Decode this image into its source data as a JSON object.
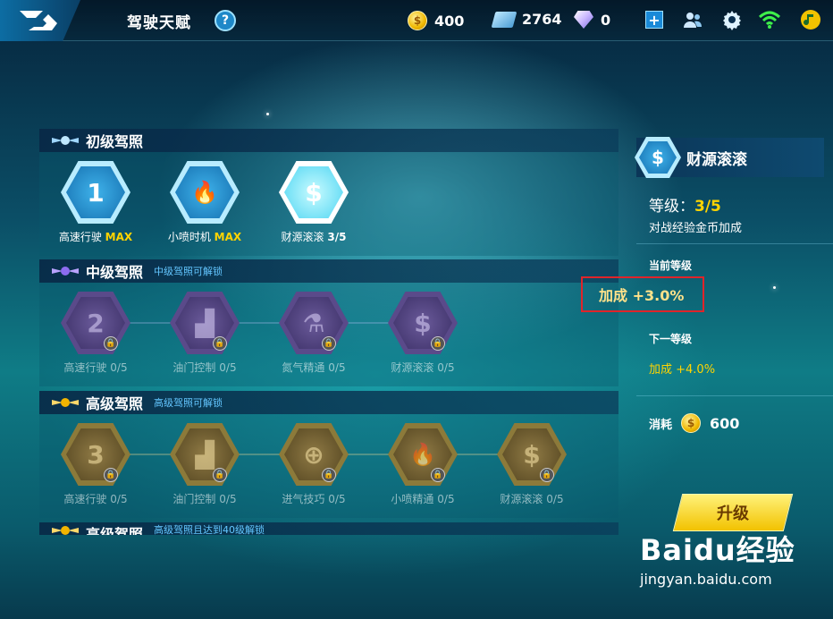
{
  "header": {
    "title": "驾驶天赋",
    "help": "?",
    "gold": "400",
    "coupons": "2764",
    "diamonds": "0",
    "add_label": "+"
  },
  "tiers": [
    {
      "name": "初级驾照",
      "subtitle": "",
      "nodes": [
        {
          "icon": "speedometer-1-icon",
          "glyph": "1",
          "label": "高速行驶",
          "level": "MAX",
          "locked": false
        },
        {
          "icon": "nitro-flame-icon",
          "glyph": "🔥",
          "label": "小喷时机",
          "level": "MAX",
          "locked": false
        },
        {
          "icon": "dollar-icon",
          "glyph": "$",
          "label": "财源滚滚",
          "level": "3/5",
          "locked": false
        }
      ]
    },
    {
      "name": "中级驾照",
      "subtitle": "中级驾照可解锁",
      "nodes": [
        {
          "icon": "speedometer-2-icon",
          "glyph": "2",
          "label": "高速行驶",
          "level": "0/5",
          "locked": true
        },
        {
          "icon": "boot-icon",
          "glyph": "▟",
          "label": "油门控制",
          "level": "0/5",
          "locked": true
        },
        {
          "icon": "nitro-bottle-icon",
          "glyph": "⚗",
          "label": "氮气精通",
          "level": "0/5",
          "locked": true
        },
        {
          "icon": "coins-icon",
          "glyph": "$",
          "label": "财源滚滚",
          "level": "0/5",
          "locked": true
        }
      ]
    },
    {
      "name": "高级驾照",
      "subtitle": "高级驾照可解锁",
      "nodes": [
        {
          "icon": "speedometer-3-icon",
          "glyph": "3",
          "label": "高速行驶",
          "level": "0/5",
          "locked": true
        },
        {
          "icon": "boot-icon",
          "glyph": "▟",
          "label": "油门控制",
          "level": "0/5",
          "locked": true
        },
        {
          "icon": "turbo-icon",
          "glyph": "⊕",
          "label": "进气技巧",
          "level": "0/5",
          "locked": true
        },
        {
          "icon": "flame-icon",
          "glyph": "🔥",
          "label": "小喷精通",
          "level": "0/5",
          "locked": true
        },
        {
          "icon": "money-bag-icon",
          "glyph": "$",
          "label": "财源滚滚",
          "level": "0/5",
          "locked": true
        }
      ]
    }
  ],
  "tier4_partial": {
    "name": "高级驾照",
    "subtitle": "高级驾照且达到40级解锁"
  },
  "detail": {
    "name": "财源滚滚",
    "level_label": "等级：",
    "level_value": "3/5",
    "description": "对战经验金币加成",
    "current_label": "当前等级",
    "current_value": "加成 +3.0%",
    "next_label": "下一等级",
    "next_value": "加成 +4.0%",
    "cost_label": "消耗",
    "cost_value": "600",
    "upgrade_label": "升级"
  },
  "watermark": {
    "main": "Baidu经验",
    "sub": "jingyan.baidu.com"
  },
  "colors": {
    "accent_gold": "#ffd400",
    "highlight_box": "#e0242a",
    "tier_blue": "#1570b0",
    "tier_purple": "#3b2f66",
    "tier_gold": "#544520"
  }
}
